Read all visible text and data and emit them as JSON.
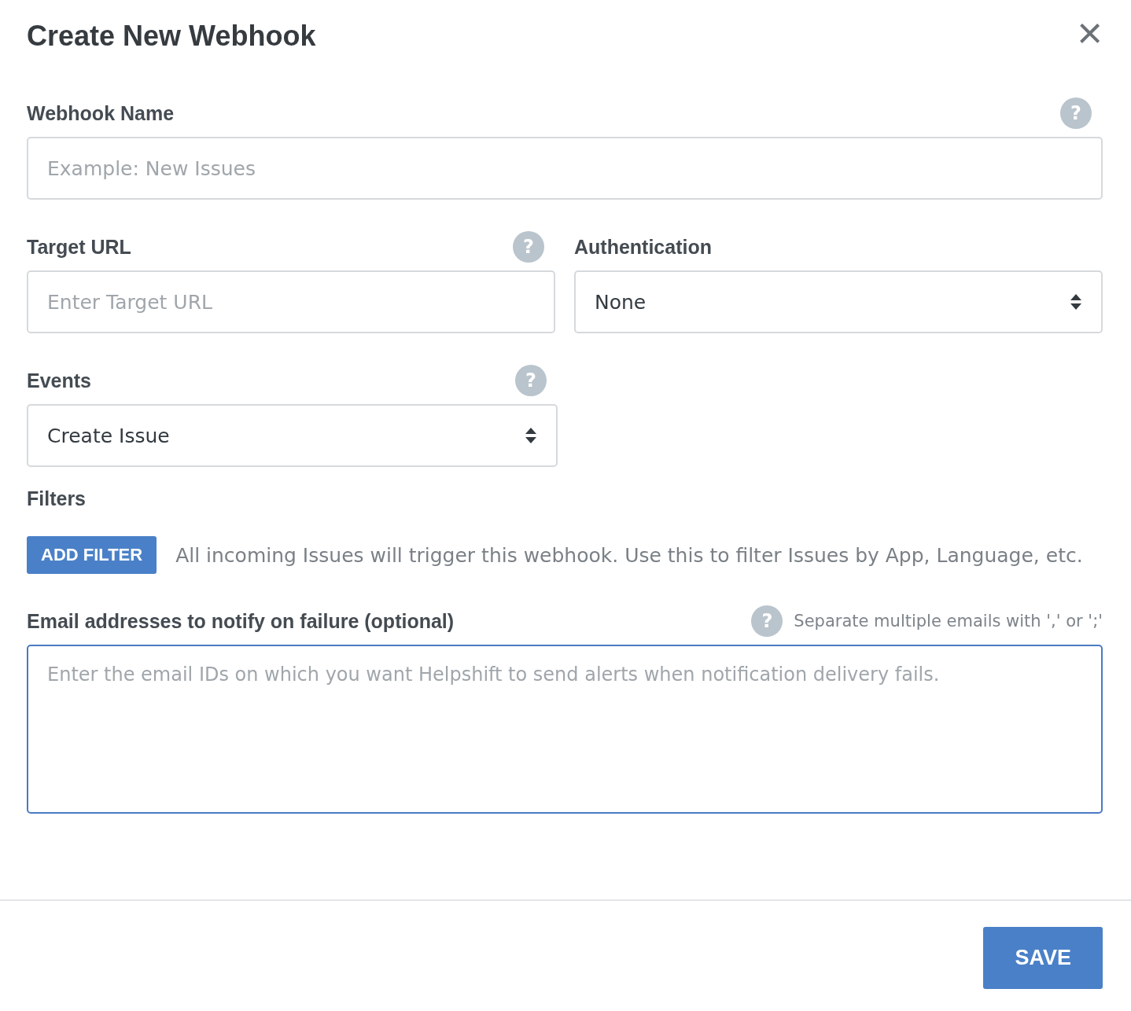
{
  "dialog": {
    "title": "Create New Webhook",
    "close": "×"
  },
  "webhook_name": {
    "label": "Webhook Name",
    "help": "?",
    "placeholder": "Example: New Issues"
  },
  "target_url": {
    "label": "Target URL",
    "help": "?",
    "placeholder": "Enter Target URL"
  },
  "authentication": {
    "label": "Authentication",
    "value": "None"
  },
  "events": {
    "label": "Events",
    "help": "?",
    "value": "Create Issue"
  },
  "filters": {
    "label": "Filters",
    "button": "ADD FILTER",
    "description": "All incoming Issues will trigger this webhook. Use this to filter Issues by App, Language, etc."
  },
  "emails": {
    "label": "Email addresses to notify on failure (optional)",
    "help": "?",
    "hint": "Separate multiple emails with ',' or ';'",
    "placeholder": "Enter the email IDs on which you want Helpshift to send alerts when notification delivery fails.",
    "focused": true
  },
  "footer": {
    "save": "SAVE"
  }
}
